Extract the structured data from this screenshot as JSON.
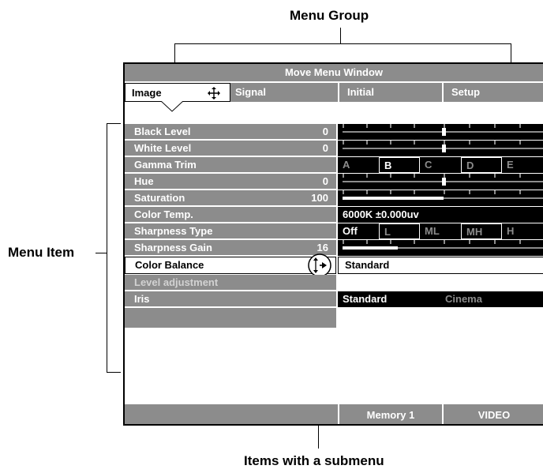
{
  "annotations": {
    "menu_group": "Menu Group",
    "menu_item": "Menu Item",
    "submenu_items": "Items with a submenu"
  },
  "window": {
    "title": "Move Menu Window"
  },
  "tabs": [
    {
      "label": "Image",
      "selected": true
    },
    {
      "label": "Signal",
      "selected": false
    },
    {
      "label": "Initial",
      "selected": false
    },
    {
      "label": "Setup",
      "selected": false
    }
  ],
  "items": [
    {
      "label": "Black Level",
      "value": "0",
      "control": "slider",
      "level": 0.5
    },
    {
      "label": "White Level",
      "value": "0",
      "control": "slider",
      "level": 0.5
    },
    {
      "label": "Gamma Trim",
      "value": "",
      "control": "choice",
      "options": [
        "A",
        "B",
        "C",
        "D",
        "E"
      ],
      "selected": "B"
    },
    {
      "label": "Hue",
      "value": "0",
      "control": "slider",
      "level": 0.5
    },
    {
      "label": "Saturation",
      "value": "100",
      "control": "bar",
      "level": 0.5
    },
    {
      "label": "Color Temp.",
      "value": "",
      "control": "text",
      "text": "6000K  ±0.000uv"
    },
    {
      "label": "Sharpness Type",
      "value": "",
      "control": "choice",
      "options": [
        "Off",
        "L",
        "ML",
        "MH",
        "H"
      ],
      "selected": "Off"
    },
    {
      "label": "Sharpness Gain",
      "value": "16",
      "control": "bar",
      "level": 0.27
    },
    {
      "label": "Color Balance",
      "value": "",
      "control": "submenu",
      "text": "Standard"
    },
    {
      "label": "Level adjustment",
      "value": "",
      "control": "empty"
    },
    {
      "label": "Iris",
      "value": "",
      "control": "pair",
      "options": [
        "Standard",
        "Cinema"
      ],
      "selected": "Standard"
    }
  ],
  "footer": {
    "memory": "Memory 1",
    "source": "VIDEO"
  },
  "icons": {
    "move": "move-arrows-icon",
    "submenu": "submenu-arrows-icon"
  },
  "colors": {
    "panel_gray": "#8c8c8c",
    "control_bg": "#000000",
    "text_light": "#ffffff",
    "dim_text": "#d2d2d2"
  }
}
